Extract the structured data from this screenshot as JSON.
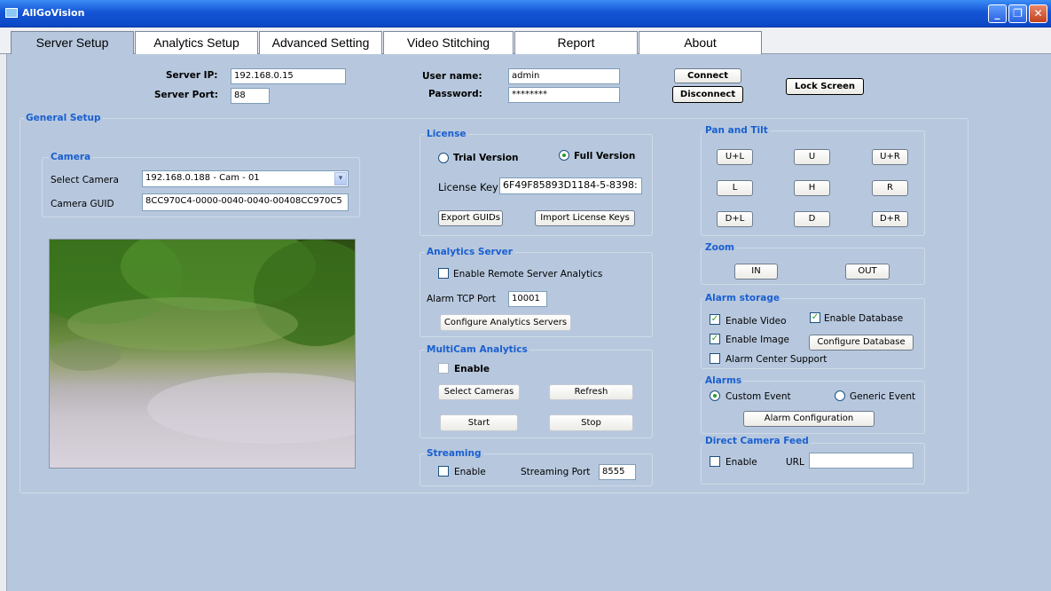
{
  "window": {
    "title": "AllGoVision",
    "buttons": [
      "_",
      "❐",
      "✕"
    ]
  },
  "tabs": [
    {
      "label": "Server Setup",
      "active": true
    },
    {
      "label": "Analytics Setup"
    },
    {
      "label": "Advanced Setting"
    },
    {
      "label": "Video Stitching"
    },
    {
      "label": "Report"
    },
    {
      "label": "About"
    }
  ],
  "server": {
    "ip_label": "Server IP:",
    "ip_value": "192.168.0.15",
    "port_label": "Server Port:",
    "port_value": "88",
    "user_label": "User name:",
    "user_value": "admin",
    "password_label": "Password:",
    "password_value": "********",
    "connect": "Connect",
    "disconnect": "Disconnect",
    "lock": "Lock Screen"
  },
  "general": {
    "title": "General Setup",
    "camera": {
      "title": "Camera",
      "select_label": "Select Camera",
      "select_value": "192.168.0.188 - Cam - 01",
      "guid_label": "Camera GUID",
      "guid_value": "8CC970C4-0000-0040-0040-00408CC970C5"
    },
    "license": {
      "title": "License",
      "trial": "Trial Version",
      "full": "Full Version",
      "key_label": "License Key",
      "key_value": "6F49F85893D1184-5-8398:",
      "export": "Export GUIDs",
      "import": "Import License Keys"
    },
    "analytics_server": {
      "title": "Analytics Server",
      "enable_remote": "Enable Remote Server Analytics",
      "tcp_label": "Alarm TCP Port",
      "tcp_value": "10001",
      "configure": "Configure Analytics Servers"
    },
    "multicam": {
      "title": "MultiCam Analytics",
      "enable": "Enable",
      "select": "Select Cameras",
      "refresh": "Refresh",
      "start": "Start",
      "stop": "Stop"
    },
    "streaming": {
      "title": "Streaming",
      "enable": "Enable",
      "port_label": "Streaming Port",
      "port_value": "8555"
    },
    "pan_tilt": {
      "title": "Pan and Tilt",
      "buttons": [
        "U+L",
        "U",
        "U+R",
        "L",
        "H",
        "R",
        "D+L",
        "D",
        "D+R"
      ]
    },
    "zoom": {
      "title": "Zoom",
      "in": "IN",
      "out": "OUT"
    },
    "alarm_storage": {
      "title": "Alarm storage",
      "video": "Enable Video",
      "database": "Enable Database",
      "image": "Enable Image",
      "configure_db": "Configure Database",
      "center": "Alarm Center Support"
    },
    "alarms": {
      "title": "Alarms",
      "custom": "Custom Event",
      "generic": "Generic Event",
      "config": "Alarm Configuration"
    },
    "direct_feed": {
      "title": "Direct Camera Feed",
      "enable": "Enable",
      "url_label": "URL",
      "url_value": ""
    }
  }
}
